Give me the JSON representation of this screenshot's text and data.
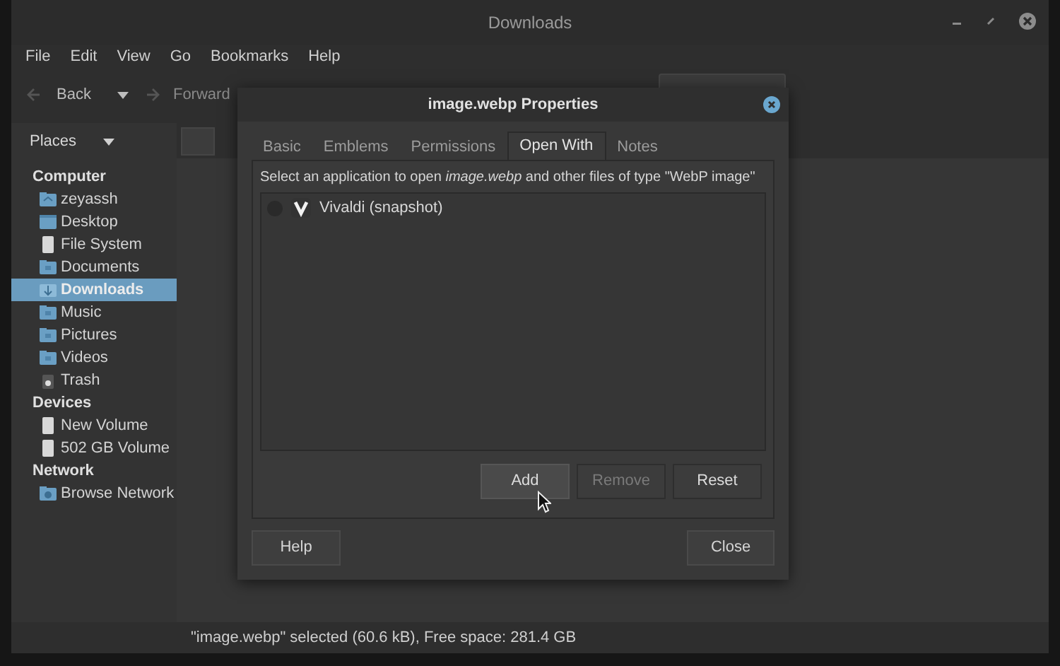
{
  "window": {
    "title": "Downloads"
  },
  "menu": [
    "File",
    "Edit",
    "View",
    "Go",
    "Bookmarks",
    "Help"
  ],
  "toolbar": {
    "back": "Back",
    "forward": "Forward"
  },
  "sidebar": {
    "header": "Places",
    "sections": [
      {
        "title": "Computer",
        "items": [
          {
            "label": "zeyassh",
            "kind": "home",
            "selected": false
          },
          {
            "label": "Desktop",
            "kind": "desktop",
            "selected": false
          },
          {
            "label": "File System",
            "kind": "drive",
            "selected": false
          },
          {
            "label": "Documents",
            "kind": "folder",
            "selected": false
          },
          {
            "label": "Downloads",
            "kind": "download",
            "selected": true
          },
          {
            "label": "Music",
            "kind": "folder",
            "selected": false
          },
          {
            "label": "Pictures",
            "kind": "folder",
            "selected": false
          },
          {
            "label": "Videos",
            "kind": "folder",
            "selected": false
          },
          {
            "label": "Trash",
            "kind": "trash",
            "selected": false
          }
        ]
      },
      {
        "title": "Devices",
        "items": [
          {
            "label": "New Volume",
            "kind": "drive",
            "selected": false
          },
          {
            "label": "502 GB Volume",
            "kind": "drive",
            "selected": false
          }
        ]
      },
      {
        "title": "Network",
        "items": [
          {
            "label": "Browse Network",
            "kind": "network",
            "selected": false
          }
        ]
      }
    ]
  },
  "status_bar": "\"image.webp\" selected (60.6 kB), Free space: 281.4 GB",
  "dialog": {
    "title": "image.webp Properties",
    "tabs": [
      {
        "label": "Basic",
        "selected": false
      },
      {
        "label": "Emblems",
        "selected": false
      },
      {
        "label": "Permissions",
        "selected": false
      },
      {
        "label": "Open With",
        "selected": true
      },
      {
        "label": "Notes",
        "selected": false
      }
    ],
    "description": "Select an application to open *image.webp* and other files of type \"WebP image\"",
    "applications": [
      {
        "name": "Vivaldi (snapshot)",
        "selected": false
      }
    ],
    "actions": [
      {
        "label": "Add",
        "disabled": false,
        "hover": true
      },
      {
        "label": "Remove",
        "disabled": true,
        "hover": false
      },
      {
        "label": "Reset",
        "disabled": false,
        "hover": false
      }
    ],
    "help": "Help",
    "close": "Close"
  }
}
